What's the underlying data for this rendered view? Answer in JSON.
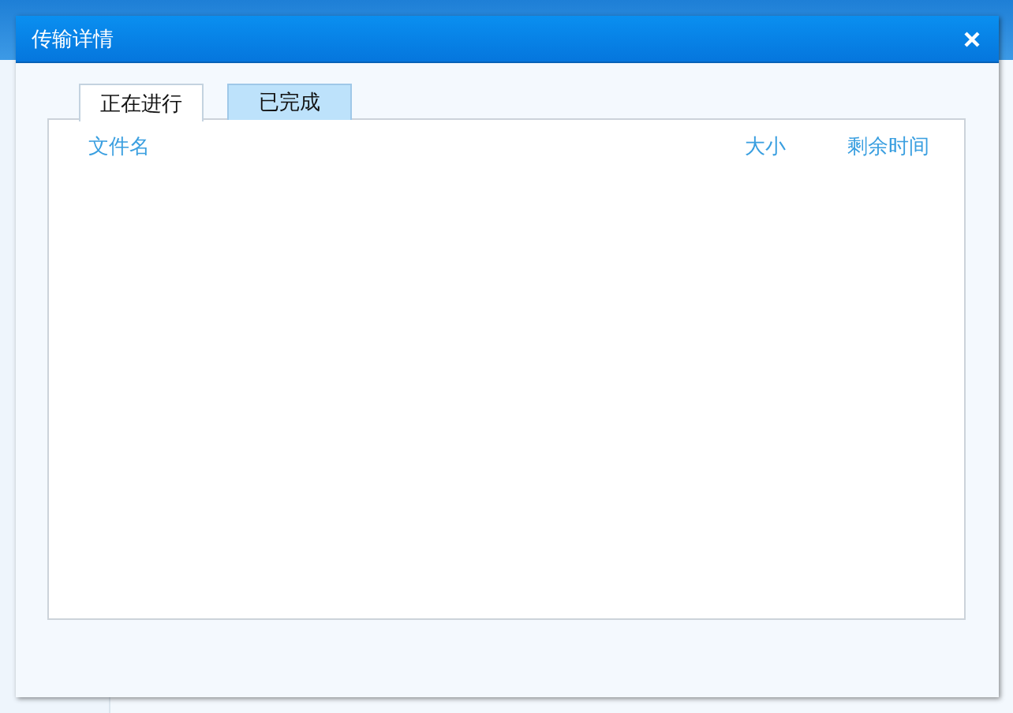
{
  "dialog": {
    "title": "传输详情"
  },
  "tabs": [
    {
      "label": "正在进行",
      "selected": true
    },
    {
      "label": "已完成",
      "selected": false
    }
  ],
  "table": {
    "columns": [
      "文件名",
      "大小",
      "剩余时间"
    ]
  }
}
